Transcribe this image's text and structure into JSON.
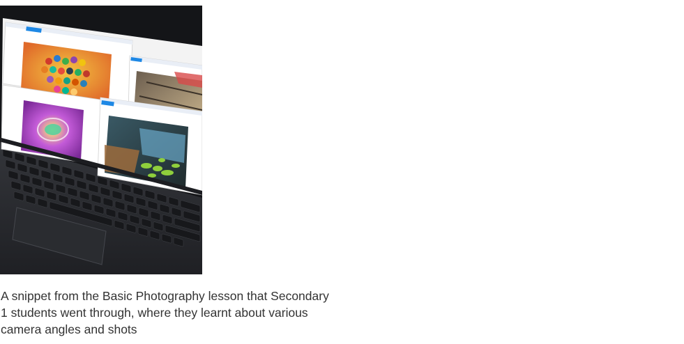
{
  "caption": "A snippet from the Basic Photography lesson that Secondary 1 students went through, where they learnt about various camera angles and shots",
  "photo": {
    "subject": "laptop-showing-student-photographs",
    "colors": {
      "background_blur": "#8a8580",
      "laptop_body": "#2b2d31",
      "screen_bg": "#f3f3f3",
      "app_accent": "#1e88e5"
    }
  }
}
